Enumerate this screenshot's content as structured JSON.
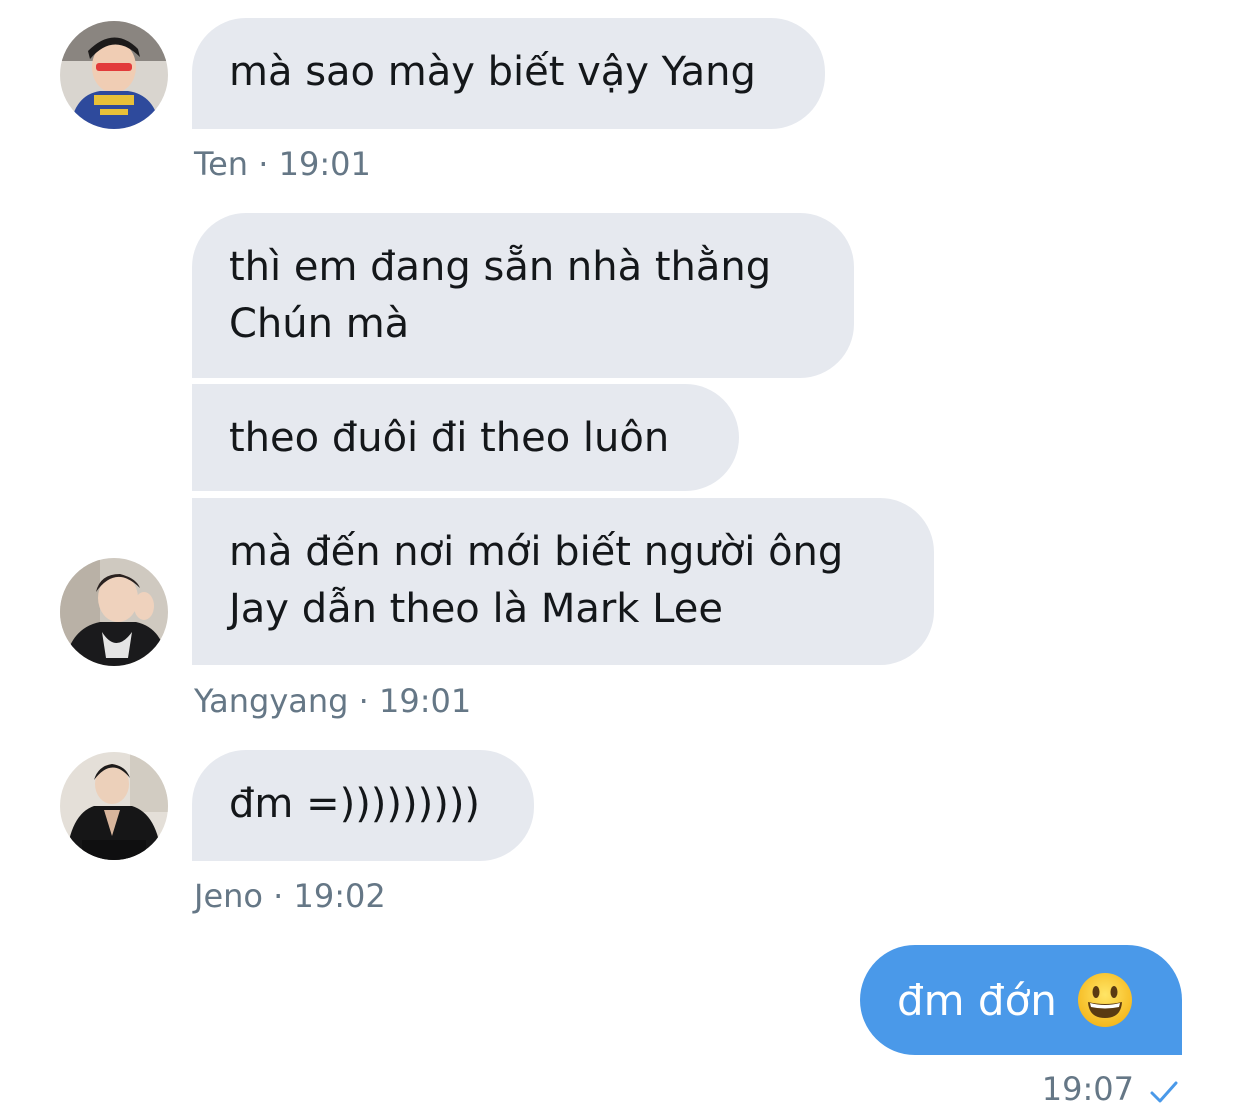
{
  "messages": [
    {
      "sender": "Ten",
      "time": "19:01",
      "texts": [
        "mà sao mày biết vậy Yang"
      ]
    },
    {
      "sender": "Yangyang",
      "time": "19:01",
      "texts": [
        "thì em đang sẵn nhà thằng",
        "Chún mà",
        "theo đuôi đi theo luôn",
        "mà đến nơi mới biết người ông",
        "Jay dẫn theo là Mark Lee"
      ]
    },
    {
      "sender": "Jeno",
      "time": "19:02",
      "texts": [
        "đm =)))))))))"
      ]
    }
  ],
  "meta": {
    "ten": "Ten · 19:01",
    "yangyang": "Yangyang · 19:01",
    "jeno": "Jeno · 19:02"
  },
  "sent": {
    "text": "đm đớn",
    "emoji": "grinning-face-emoji",
    "time": "19:07",
    "status_icon": "check-icon"
  },
  "colors": {
    "received_bubble": "#e6e9ef",
    "sent_bubble": "#4a99e9",
    "meta_text": "#657786",
    "check": "#4a99e9"
  }
}
